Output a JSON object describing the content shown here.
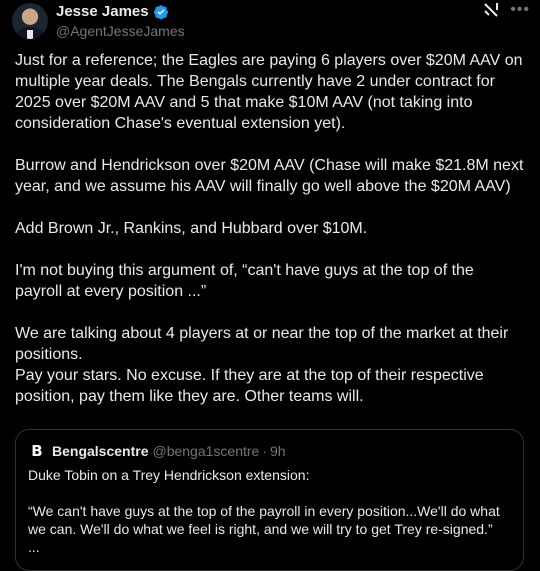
{
  "author": {
    "display_name": "Jesse James",
    "handle": "@AgentJesseJames"
  },
  "icons": {
    "verified": "verified-badge-icon",
    "grok": "grok-icon",
    "more": "more-icon"
  },
  "colors": {
    "background": "#000000",
    "text": "#e7e9ea",
    "secondary_text": "#71767b",
    "verified_blue": "#1d9bf0",
    "border": "#2f3336"
  },
  "tweet": {
    "paragraphs": [
      "Just for a reference; the Eagles are paying 6 players over $20M AAV on multiple year deals. The Bengals currently have 2 under contract for 2025 over $20M AAV and 5 that make $10M AAV (not taking into consideration Chase's eventual extension yet).",
      "Burrow and Hendrickson over $20M AAV (Chase will make $21.8M next year, and we assume his AAV will finally go well above the $20M AAV)",
      "Add Brown Jr., Rankins, and Hubbard over $10M.",
      "I'm not buying this argument of, “can't have guys at the top of the payroll at every position ...”",
      "We are talking about 4 players at or near the top of the market at their positions.",
      "Pay your stars. No excuse. If they are at the top of their respective position, pay them like they are. Other teams will."
    ]
  },
  "quote": {
    "name": "Bengalscentre",
    "handle": "@benga1scentre",
    "separator": "·",
    "time": "9h",
    "line1": "Duke Tobin on a Trey Hendrickson extension:",
    "line2": "“We can't have guys at the top of the payroll in every position...We'll do what we can. We'll do what we feel is right, and we will try to get Trey re-signed.”",
    "ellipsis": "..."
  }
}
